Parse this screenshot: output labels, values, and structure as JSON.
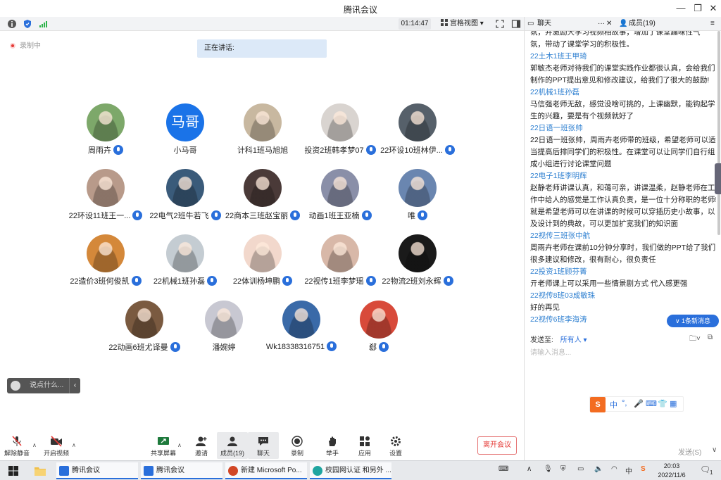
{
  "window": {
    "title": "腾讯会议",
    "min": "—",
    "restore": "❐",
    "close": "✕"
  },
  "meeting": {
    "timer": "01:14:47",
    "view_label": "宫格视图",
    "recording_label": "录制中",
    "speaking_label": "正在讲话:",
    "chat_placeholder": "说点什么..."
  },
  "participants": [
    {
      "name": "周雨卉",
      "color": "#7da86a",
      "mic": true
    },
    {
      "name": "小马哥",
      "avatar_text": "马哥",
      "color": "#1a73e8",
      "mic": false
    },
    {
      "name": "计科1班马旭旭",
      "color": "#c8b8a0",
      "mic": false
    },
    {
      "name": "投资2班韩孝梦07",
      "color": "#d9d4d0",
      "mic": true
    },
    {
      "name": "22环设10班林伊...",
      "color": "#56606a",
      "mic": true
    },
    {
      "name": "22环设11班王一...",
      "color": "#b89a8a",
      "mic": true
    },
    {
      "name": "22电气2班牛若飞",
      "color": "#3a5b7a",
      "mic": true
    },
    {
      "name": "22商本三班赵宝丽",
      "color": "#4a3a38",
      "mic": true
    },
    {
      "name": "动画1班王亚楠",
      "color": "#8a8fa8",
      "mic": true
    },
    {
      "name": "唯",
      "color": "#6a86b0",
      "mic": true
    },
    {
      "name": "22造价3班何俊凯",
      "color": "#d4883a",
      "mic": true
    },
    {
      "name": "22机械1班孙磊",
      "color": "#c4ccd2",
      "mic": true
    },
    {
      "name": "22体训杨坤鹏",
      "color": "#f2d8cc",
      "mic": true
    },
    {
      "name": "22视传1班李梦瑶",
      "color": "#d8b8a8",
      "mic": true
    },
    {
      "name": "22物流2班刘永辉",
      "color": "#1a1a1a",
      "mic": true
    },
    {
      "name": "22动画6班尤译曼",
      "color": "#7a5a40",
      "mic": true
    },
    {
      "name": "潘婉婷",
      "color": "#c8c8d2",
      "mic": false
    },
    {
      "name": "Wk18338316751",
      "color": "#3a6aa8",
      "mic": true
    },
    {
      "name": "郄",
      "color": "#d84a3a",
      "mic": true
    }
  ],
  "toolbar": {
    "unmute": "解除静音",
    "video": "开启视频",
    "share": "共享屏幕",
    "invite": "邀请",
    "members": "成员(19)",
    "chat": "聊天",
    "record": "录制",
    "raise": "举手",
    "apps": "应用",
    "settings": "设置",
    "leave": "离开会议"
  },
  "panel": {
    "tab_chat": "聊天",
    "tab_members": "成员(19)",
    "more": "···",
    "messages": [
      {
        "t": "text",
        "v": "氛，并激励大学习视频相故事，增加了课堂趣味性气"
      },
      {
        "t": "text",
        "v": "氛，带动了课堂学习的积极性。"
      },
      {
        "t": "sender",
        "v": "22土木1班王甲琦"
      },
      {
        "t": "text",
        "v": "郭敏杰老师对待我们的课堂实践作业都很认真，会给我们"
      },
      {
        "t": "text",
        "v": "制作的PPT提出意见和修改建议，给我们了很大的鼓励!"
      },
      {
        "t": "sender",
        "v": "22机械1班孙磊"
      },
      {
        "t": "text",
        "v": "马信强老师无敌，感觉没啥可挑的，上课幽默，能钩起学"
      },
      {
        "t": "text",
        "v": "生的兴趣，要是有个视频就好了"
      },
      {
        "t": "sender",
        "v": "22日语一班张帅"
      },
      {
        "t": "text",
        "v": "22日语一班张帅，周雨卉老师带的班级，希望老师可以适"
      },
      {
        "t": "text",
        "v": "当提高后排同学们的积极性。在课堂可以让同学们自行组"
      },
      {
        "t": "text",
        "v": "成小组进行讨论课堂问题"
      },
      {
        "t": "sender",
        "v": "22电子1班李明辉"
      },
      {
        "t": "text",
        "v": "赵静老师讲课认真，和蔼可亲，讲课温柔，赵静老师在工"
      },
      {
        "t": "text",
        "v": "作中给人的感觉是工作认真负责，是一位十分称职的老师!"
      },
      {
        "t": "text",
        "v": "就是希望老师可以在讲课的时候可以穿插历史小故事，以"
      },
      {
        "t": "text",
        "v": "及设计到的典故，可以更加扩宽我们的知识面"
      },
      {
        "t": "sender",
        "v": "22视传三班张中航"
      },
      {
        "t": "text",
        "v": "周雨卉老师在课前10分钟分享时，我们做的PPT给了我们"
      },
      {
        "t": "text",
        "v": "很多建议和修改，很有耐心，很负责任"
      },
      {
        "t": "sender",
        "v": "22投资1班顾芬菁"
      },
      {
        "t": "text",
        "v": "亓老师课上可以采用一些情景剧方式 代入感更强"
      },
      {
        "t": "sender",
        "v": "22视传8班03成敏珠"
      },
      {
        "t": "text",
        "v": "好的再见"
      },
      {
        "t": "sender",
        "v": "22视传6班李海涛"
      }
    ],
    "new_msg": "∨ 1条新消息",
    "send_to_label": "发送至:",
    "send_to_value": "所有人 ▾",
    "input_placeholder": "请输入消息...",
    "send": "发送(S)",
    "ime": [
      "中",
      "°,",
      "🎤",
      "⌨",
      "👕",
      "▦"
    ]
  },
  "taskbar": {
    "apps": [
      "腾讯会议",
      "腾讯会议",
      "新建 Microsoft Po...",
      "校园网认证 和另外 ..."
    ],
    "time": "20:03",
    "date": "2022/11/6",
    "badge": "1"
  }
}
